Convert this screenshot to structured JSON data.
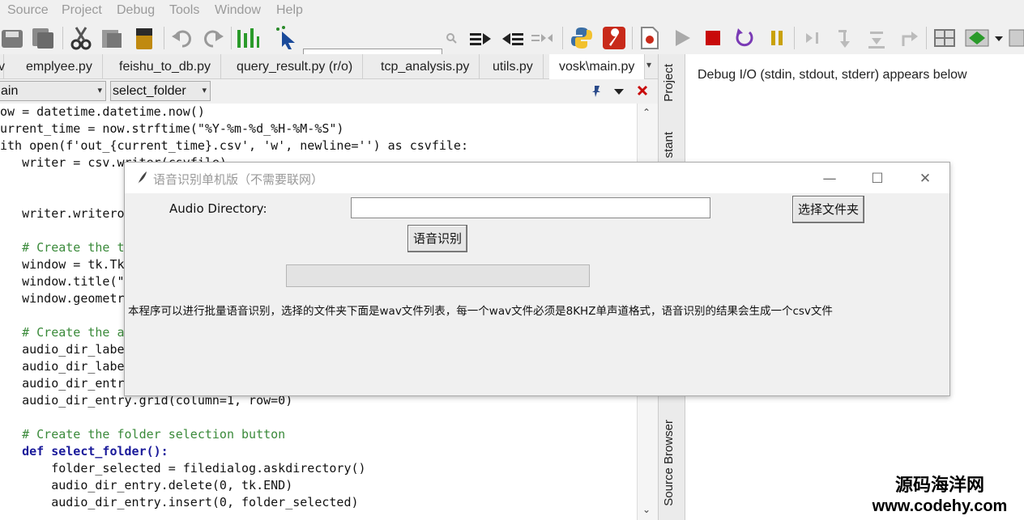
{
  "menu": [
    "Source",
    "Project",
    "Debug",
    "Tools",
    "Window",
    "Help"
  ],
  "toolbar": {
    "search_value": "",
    "icons": [
      "save-all-icon",
      "copy-icon",
      "cut-icon",
      "paste-icon",
      "notes-icon",
      "undo-icon",
      "redo-icon",
      "indent-guide-icon",
      "select-tool-icon",
      "search-icon",
      "indent-icon",
      "outdent-icon",
      "wrap-icon",
      "python-icon",
      "wrench-icon",
      "record-icon",
      "run-icon",
      "stop-icon",
      "restart-icon",
      "pause-icon",
      "step-into-icon",
      "step-over-icon",
      "step-out-icon",
      "step-return-icon",
      "layout-icon",
      "perspective-icon"
    ]
  },
  "tabs": [
    "emplyee.py",
    "feishu_to_db.py",
    "query_result.py (r/o)",
    "tcp_analysis.py",
    "utils.py",
    "vosk\\main.py"
  ],
  "subbar": {
    "scope": "ain",
    "function": "select_folder"
  },
  "code_lines": [
    "ow = datetime.datetime.now()",
    "urrent_time = now.strftime(\"%Y-%m-%d_%H-%M-%S\")",
    "ith open(f'out_{current_time}.csv', 'w', newline='') as csvfile:",
    "   writer = csv.writer(csvfile)",
    "",
    "",
    "   writer.writerow(",
    "",
    "   # Create the t",
    "   window = tk.Tk",
    "   window.title(\"",
    "   window.geometr",
    "",
    "   # Create the a",
    "   audio_dir_labe",
    "   audio_dir_labe",
    "   audio_dir_entr",
    "   audio_dir_entry.grid(column=1, row=0)",
    "",
    "   # Create the folder selection button",
    "   def select_folder():",
    "       folder_selected = filedialog.askdirectory()",
    "       audio_dir_entry.delete(0, tk.END)",
    "       audio_dir_entry.insert(0, folder_selected)"
  ],
  "side_tabs": {
    "project": "Project",
    "assistant": "stant",
    "source_browser": "Source Browser"
  },
  "debug": {
    "header": "Debug I/O (stdin, stdout, stderr) appears below"
  },
  "dialog": {
    "title": "语音识别单机版（不需要联网）",
    "audio_label": "Audio Directory:",
    "audio_value": "",
    "choose_folder_button": "选择文件夹",
    "recognize_button": "语音识别",
    "progress": 0,
    "description": "本程序可以进行批量语音识别，选择的文件夹下面是wav文件列表，每一个wav文件必须是8KHZ单声道格式，语音识别的结果会生成一个csv文件",
    "minimize": "—",
    "maximize": "☐",
    "close": "✕"
  },
  "watermark": {
    "line1": "源码海洋网",
    "line2": "www.codehy.com"
  }
}
